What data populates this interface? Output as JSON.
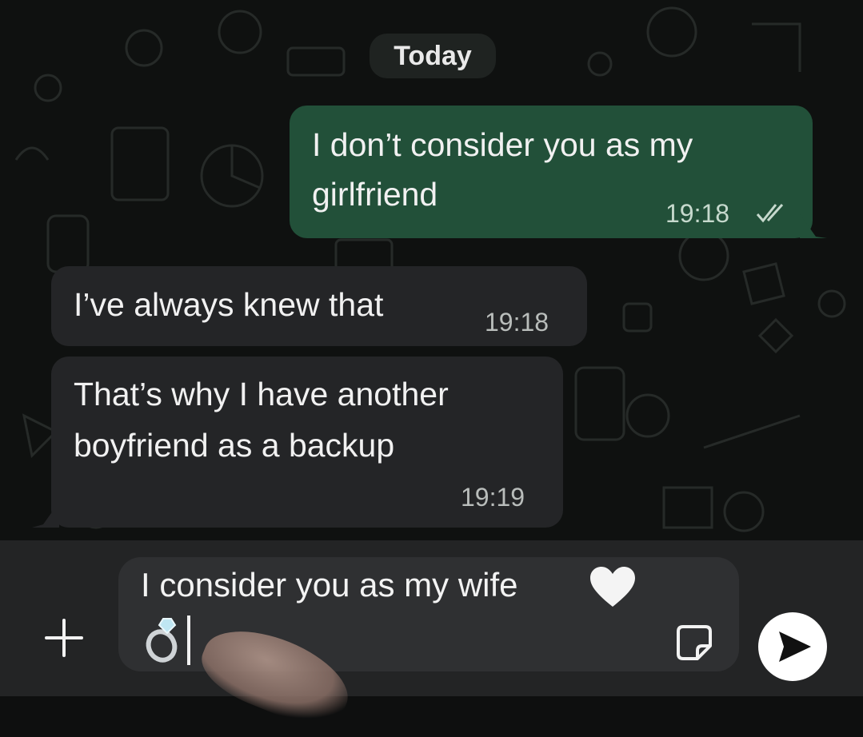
{
  "date_divider": "Today",
  "messages": [
    {
      "direction": "outgoing",
      "lines": [
        "I don’t consider you as my",
        "girlfriend"
      ],
      "time": "19:18",
      "status": "read"
    },
    {
      "direction": "incoming",
      "lines": [
        "I’ve always knew that"
      ],
      "time": "19:18"
    },
    {
      "direction": "incoming",
      "lines": [
        "That’s why I have another",
        "boyfriend as a backup"
      ],
      "time": "19:19"
    }
  ],
  "composer": {
    "text": "I consider you as my wife",
    "emoji_heart": "white-heart",
    "emoji_ring": "ring"
  },
  "icons": {
    "attach": "plus-icon",
    "sticker": "sticker-icon",
    "send": "send-icon",
    "read_receipt": "double-check-icon"
  },
  "colors": {
    "outgoing_bubble": "#225039",
    "incoming_bubble": "#242527",
    "chat_background": "#0f1110",
    "input_bar": "#232425"
  }
}
